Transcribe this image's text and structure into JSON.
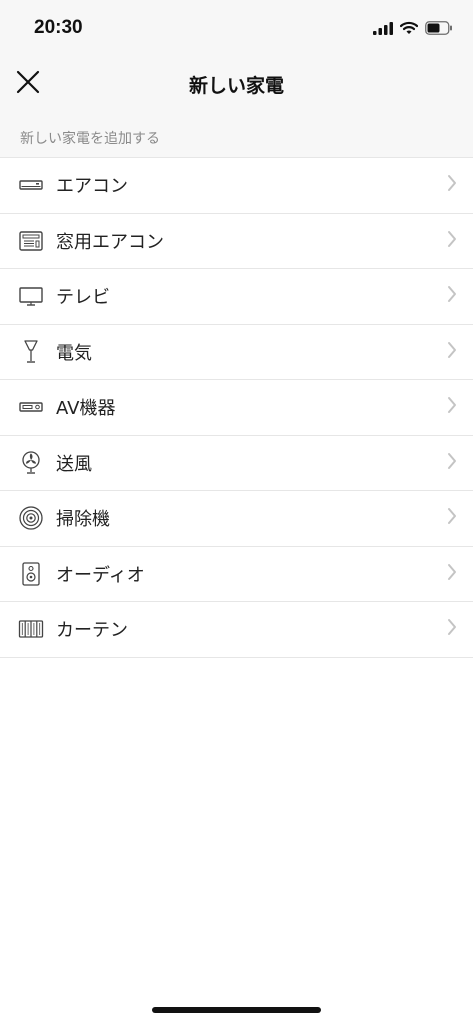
{
  "status_bar": {
    "time": "20:30"
  },
  "header": {
    "title": "新しい家電"
  },
  "section": {
    "label": "新しい家電を追加する"
  },
  "items": [
    {
      "label": "エアコン",
      "icon": "air-conditioner-icon"
    },
    {
      "label": "窓用エアコン",
      "icon": "window-air-conditioner-icon"
    },
    {
      "label": "テレビ",
      "icon": "tv-icon"
    },
    {
      "label": "電気",
      "icon": "light-icon"
    },
    {
      "label": "AV機器",
      "icon": "av-device-icon"
    },
    {
      "label": "送風",
      "icon": "fan-icon"
    },
    {
      "label": "掃除機",
      "icon": "vacuum-icon"
    },
    {
      "label": "オーディオ",
      "icon": "speaker-icon"
    },
    {
      "label": "カーテン",
      "icon": "curtain-icon"
    }
  ]
}
